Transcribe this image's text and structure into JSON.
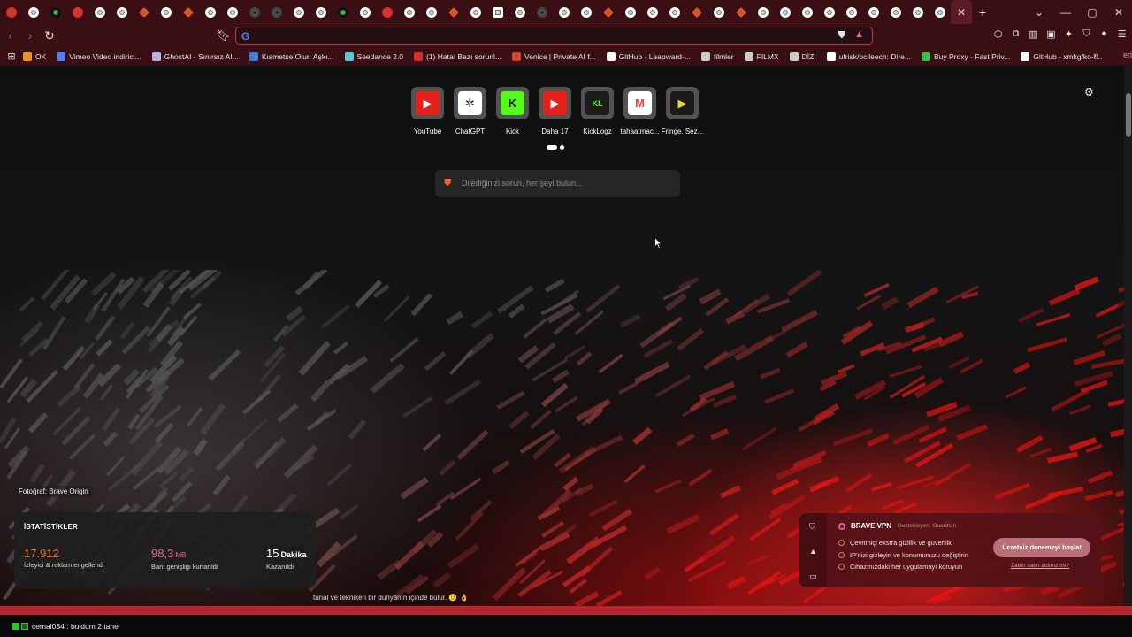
{
  "window": {
    "controls": {
      "minimize": "—",
      "maximize": "▢",
      "close": "✕",
      "dropdown": "⌄"
    }
  },
  "tabs": {
    "count_before_active": 43,
    "active_close": "✕",
    "new_tab": "+"
  },
  "toolbar": {
    "back": "‹",
    "forward": "›",
    "reload": "↻",
    "address_value": "",
    "search_engine_icon": "G"
  },
  "bookmarks": [
    {
      "label": "OK",
      "color": "#e8961e"
    },
    {
      "label": "Vimeo Video indirici...",
      "color": "#4f7ef5"
    },
    {
      "label": "GhostAI - Sınırsız AI...",
      "color": "#bdb2e8"
    },
    {
      "label": "Kısmetse Olur: Aşkı...",
      "color": "#3d7be0"
    },
    {
      "label": "Seedance 2.0",
      "color": "#5ac8d8"
    },
    {
      "label": "(1) Hata! Bazı sorunl...",
      "color": "#d62d2d"
    },
    {
      "label": "Venice | Private AI f...",
      "color": "#d0462a"
    },
    {
      "label": "GitHub - Leapward-...",
      "color": "#ffffff"
    },
    {
      "label": "filmler",
      "color": "#cccccc"
    },
    {
      "label": "FILMX",
      "color": "#cccccc"
    },
    {
      "label": "DİZİ",
      "color": "#cccccc"
    },
    {
      "label": "ufrisk/pcileech: Dire...",
      "color": "#ffffff"
    },
    {
      "label": "Buy Proxy - Fast Priv...",
      "color": "#3db84a"
    },
    {
      "label": "GitHub - xmkg/ko-t...",
      "color": "#ffffff"
    }
  ],
  "bookmarks_more": "»",
  "bookmarks_overflow": "eri",
  "ntp": {
    "top_sites": [
      {
        "label": "YouTube",
        "icon": "youtube-icon",
        "bg": "#e62117",
        "fg": "#fff",
        "glyph": "▶"
      },
      {
        "label": "ChatGPT",
        "icon": "chatgpt-icon",
        "bg": "#ffffff",
        "fg": "#111",
        "glyph": "✲"
      },
      {
        "label": "Kick",
        "icon": "kick-icon",
        "bg": "#53fc18",
        "fg": "#111",
        "glyph": "K"
      },
      {
        "label": "Daha 17",
        "icon": "youtube-icon",
        "bg": "#e62117",
        "fg": "#fff",
        "glyph": "▶"
      },
      {
        "label": "KickLogz",
        "icon": "kicklogz-icon",
        "bg": "#1c1c1c",
        "fg": "#53fc18",
        "glyph": "KL"
      },
      {
        "label": "tahaatmac...",
        "icon": "gmail-icon",
        "bg": "#ffffff",
        "fg": "#ea4335",
        "glyph": "M"
      },
      {
        "label": "Fringe, Sez...",
        "icon": "play-icon",
        "bg": "#1a1a1a",
        "fg": "#e8d23a",
        "glyph": "▶"
      }
    ],
    "search_placeholder": "Dilediğinizi sorun, her şeyi bulun...",
    "photo_credit": "Fotoğraf: Brave Origin",
    "stats": {
      "title": "İSTATİSTİKLER",
      "trackers": {
        "value": "17.912",
        "label": "İzleyici & reklam engellendi",
        "color": "#f0703a"
      },
      "bandwidth": {
        "value": "98,3",
        "unit": "MB",
        "label": "Bant genişliği kurtarıldı",
        "color": "#f06a8a"
      },
      "time": {
        "value": "15",
        "unit": "Dakika",
        "label": "Kazanıldı",
        "color": "#ffffff"
      }
    },
    "vpn": {
      "brand": "BRAVE VPN",
      "sponsor": "Destekleyen: Guardian",
      "features": [
        "Çevrimiçi ekstra gizlilik ve güvenlik",
        "IP'nizi gizleyin ve konumunuzu değiştirin",
        "Cihazınızdaki her uygulamayı koruyun"
      ],
      "cta": "Ücretsiz denemeyi başlat",
      "already": "Zaten satın aldınız mı?"
    },
    "caption_text": "tunal ve teknikeri bir dünyanın içinde bulur. 🙂 👌"
  },
  "bottom_bar": {
    "text": "cemal034 : buldum 2 tane"
  }
}
